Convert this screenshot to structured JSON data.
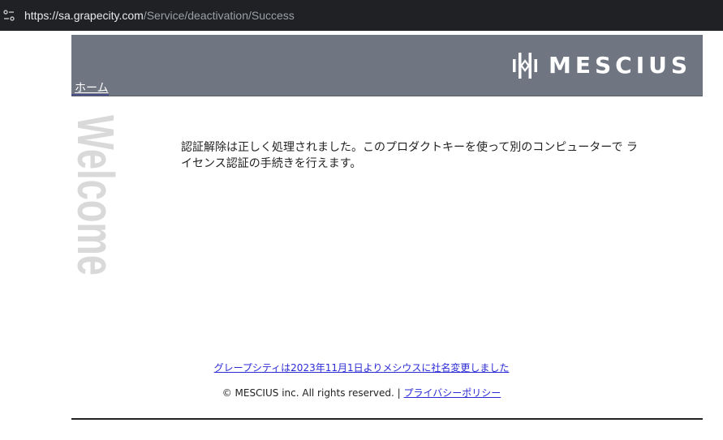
{
  "browser": {
    "url_host": "https://sa.grapecity.com",
    "url_path": "/Service/deactivation/Success",
    "site_info_icon": "tune-icon"
  },
  "header": {
    "logo_text": "MESCIUS",
    "home_link": "ホーム",
    "background_color": "#6f7581"
  },
  "sidebar": {
    "welcome_text": "Welcome"
  },
  "main": {
    "message": "認証解除は正しく処理されました。このプロダクトキーを使って別のコンピューターで ライセンス認証の手続きを行えます。"
  },
  "footer": {
    "rename_notice": "グレープシティは2023年11月1日よりメシウスに社名変更しました",
    "copyright": "© MESCIUS inc. All rights reserved. |",
    "privacy_policy": "プライバシーポリシー",
    "link_color": "#2b2bd6"
  }
}
